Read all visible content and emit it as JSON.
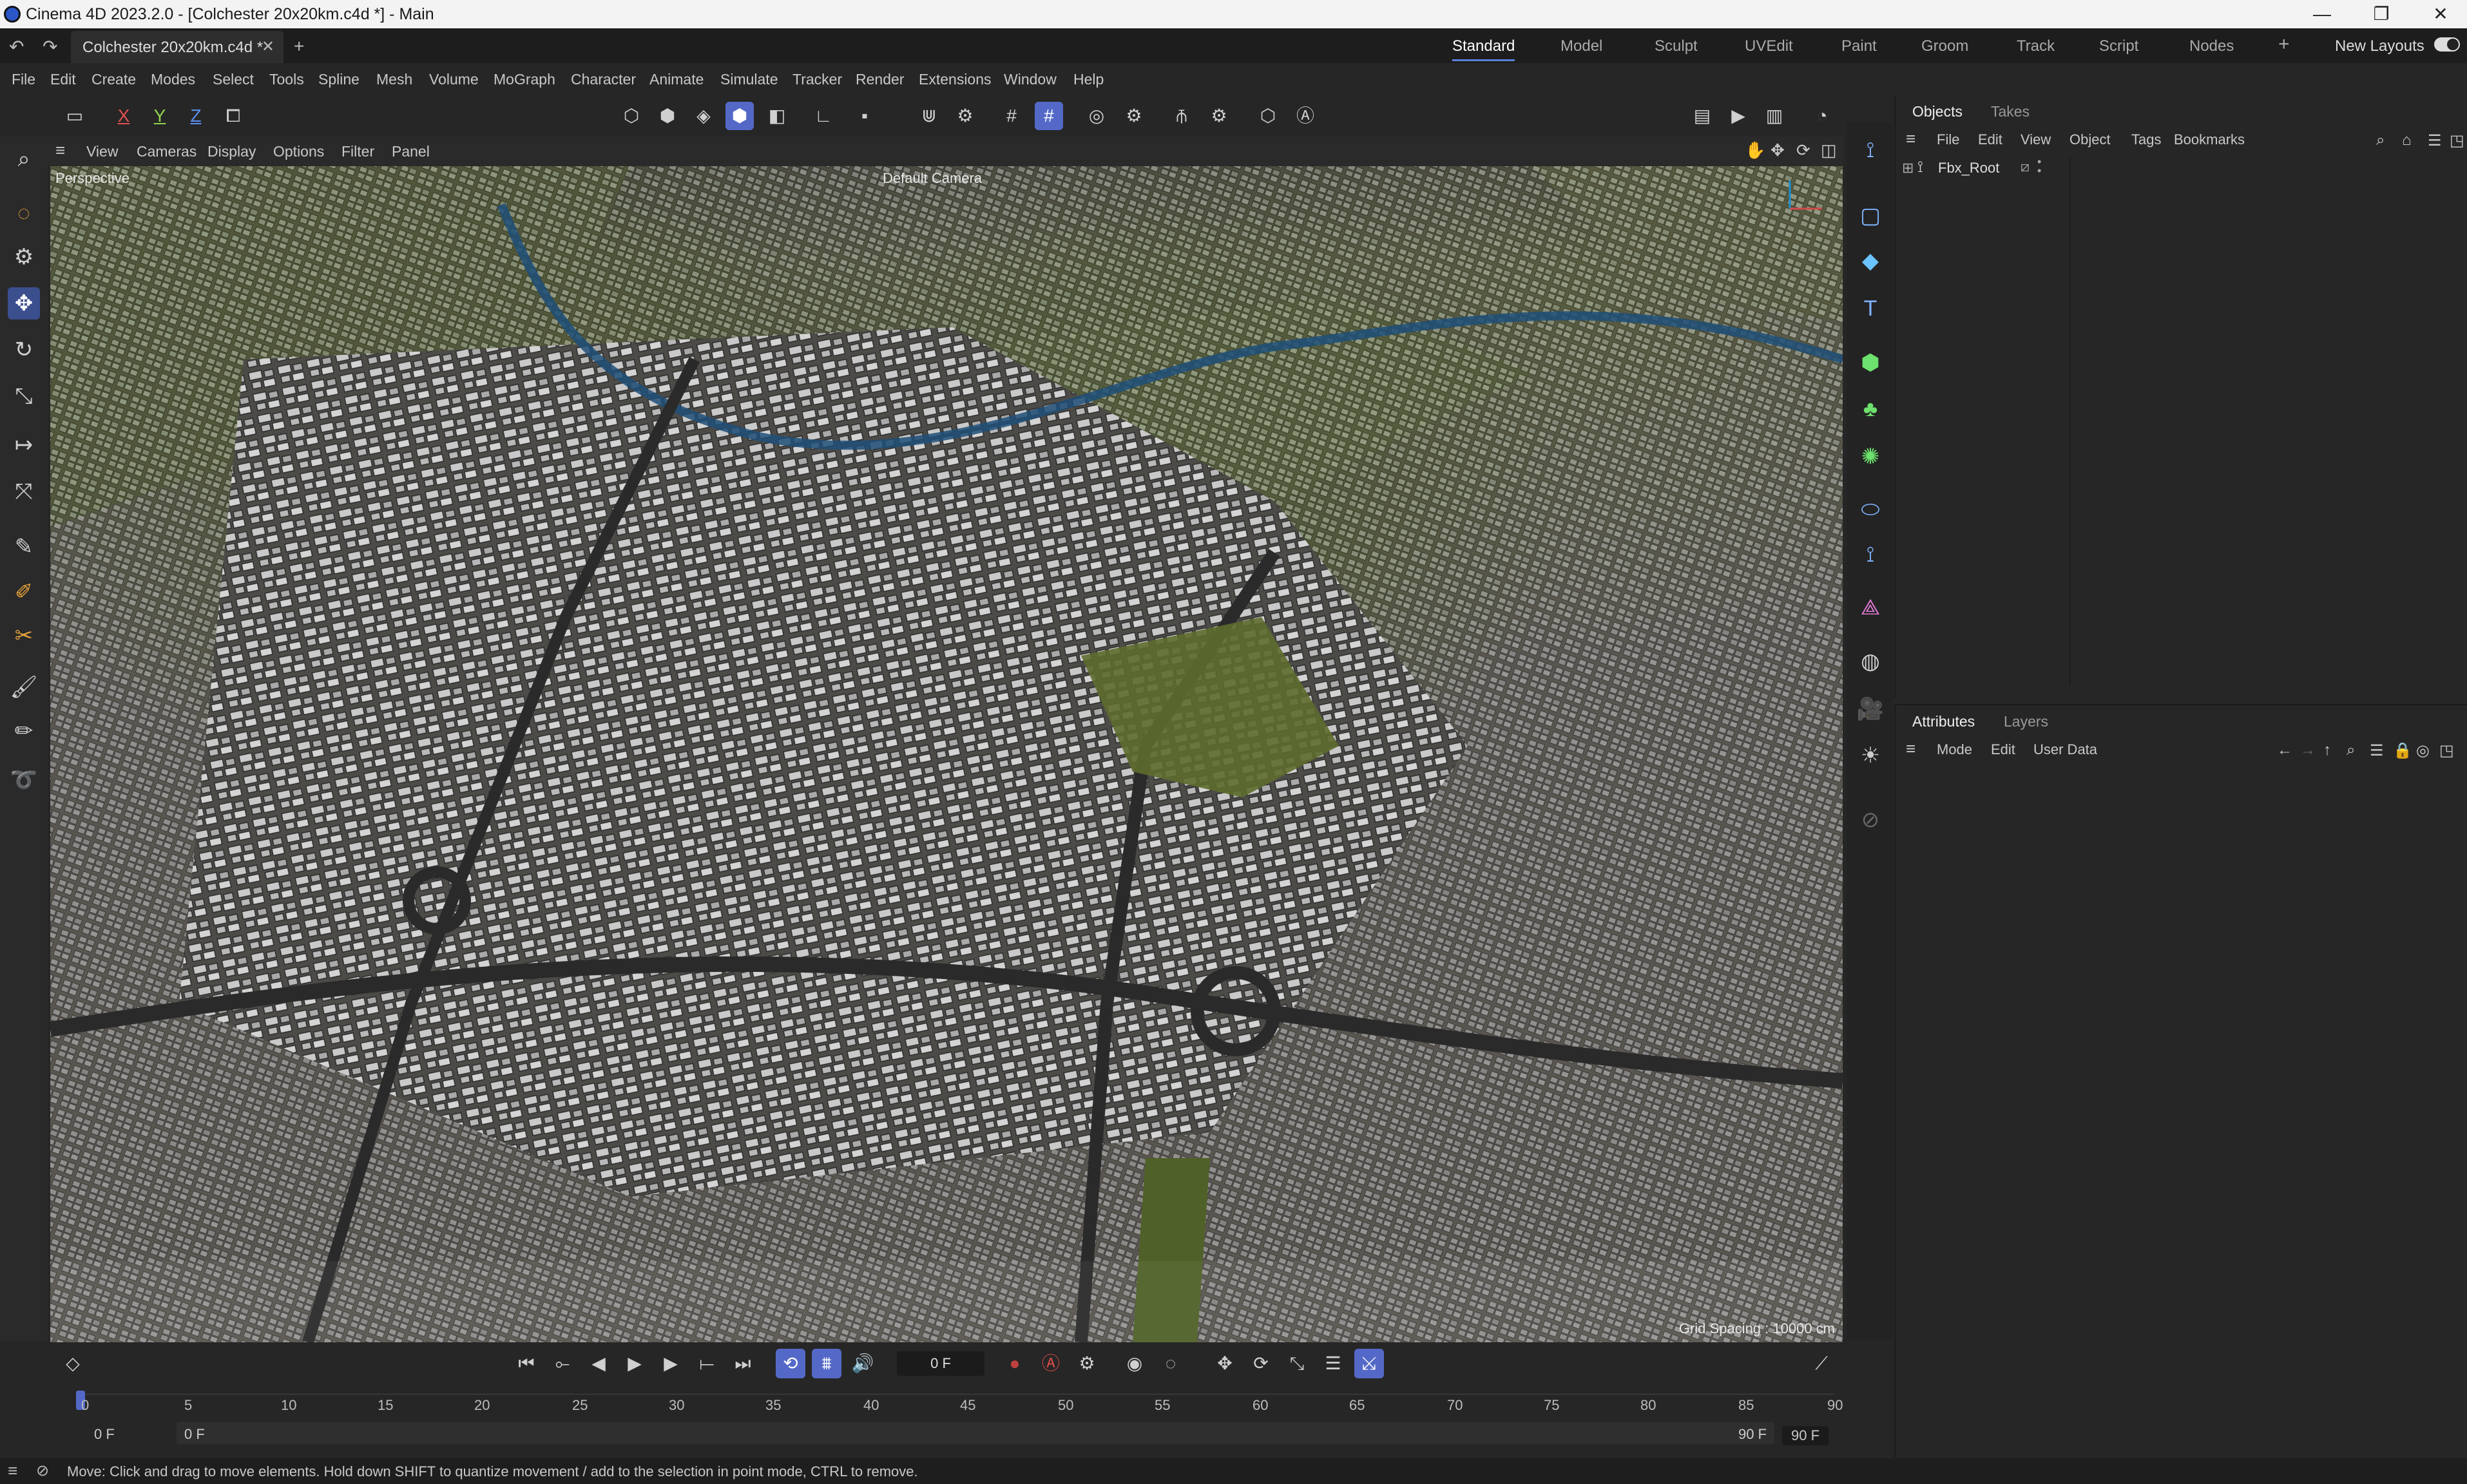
{
  "window": {
    "title": "Cinema 4D 2023.2.0 - [Colchester 20x20km.c4d *] - Main",
    "controls": [
      "—",
      "❐",
      "✕"
    ]
  },
  "tabbar": {
    "document_tab": "Colchester 20x20km.c4d *",
    "layouts": [
      "Standard",
      "Model",
      "Sculpt",
      "UVEdit",
      "Paint",
      "Groom",
      "Track",
      "Script",
      "Nodes"
    ],
    "active_layout": "Standard",
    "new_layouts": "New Layouts"
  },
  "menu": [
    "File",
    "Edit",
    "Create",
    "Modes",
    "Select",
    "Tools",
    "Spline",
    "Mesh",
    "Volume",
    "MoGraph",
    "Character",
    "Animate",
    "Simulate",
    "Tracker",
    "Render",
    "Extensions",
    "Window",
    "Help"
  ],
  "toolbar": {
    "axes": [
      "X",
      "Y",
      "Z"
    ]
  },
  "viewport": {
    "menu": [
      "View",
      "Cameras",
      "Display",
      "Options",
      "Filter",
      "Panel"
    ],
    "projection": "Perspective",
    "camera": "Default Camera",
    "grid_spacing": "Grid Spacing : 10000 cm"
  },
  "objects_panel": {
    "tabs": [
      "Objects",
      "Takes"
    ],
    "active_tab": "Objects",
    "menu": [
      "File",
      "Edit",
      "View",
      "Object",
      "Tags",
      "Bookmarks"
    ],
    "items": [
      {
        "name": "Fbx_Root"
      }
    ]
  },
  "attributes_panel": {
    "tabs": [
      "Attributes",
      "Layers"
    ],
    "active_tab": "Attributes",
    "menu": [
      "Mode",
      "Edit",
      "User Data"
    ]
  },
  "timeline": {
    "current_frame": "0 F",
    "ticks": [
      "0",
      "5",
      "10",
      "15",
      "20",
      "25",
      "30",
      "35",
      "40",
      "45",
      "50",
      "55",
      "60",
      "65",
      "70",
      "75",
      "80",
      "85",
      "90"
    ],
    "min": "0 F",
    "start": "0 F",
    "end": "90 F",
    "max": "90 F"
  },
  "status": {
    "message": "Move: Click and drag to move elements. Hold down SHIFT to quantize movement / add to the selection in point mode, CTRL to remove."
  },
  "colors": {
    "accent": "#5469c7",
    "background": "#262626"
  }
}
